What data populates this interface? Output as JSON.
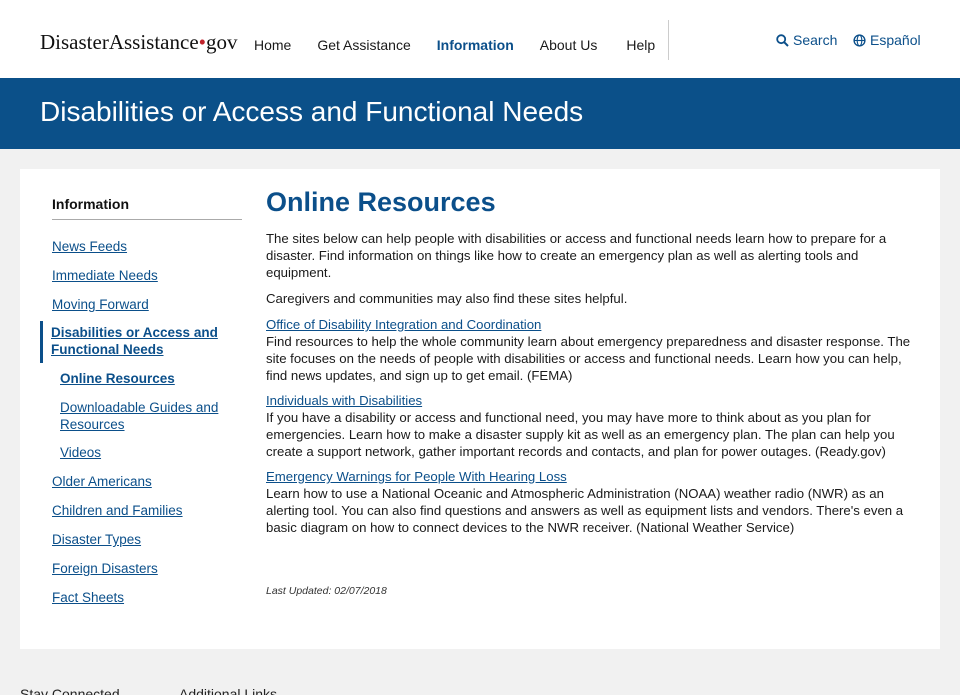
{
  "header": {
    "logo_main": "Disaster",
    "logo_second": "Assistance",
    "logo_dot": "•",
    "logo_tld": "gov",
    "nav": [
      "Home",
      "Get Assistance",
      "Information",
      "About Us",
      "Help"
    ],
    "search_label": "Search",
    "espanol_label": "Español"
  },
  "banner": {
    "title": "Disabilities or Access and Functional Needs"
  },
  "sidebar": {
    "title": "Information",
    "items": [
      "News Feeds",
      "Immediate Needs",
      "Moving Forward",
      "Disabilities or Access and Functional Needs",
      "Online Resources",
      "Downloadable Guides and Resources",
      "Videos",
      "Older Americans",
      "Children and Families",
      "Disaster Types",
      "Foreign Disasters",
      "Fact Sheets"
    ]
  },
  "main": {
    "title": "Online Resources",
    "intro1": "The sites below can help people with disabilities or access and functional needs learn how to prepare for a disaster. Find information on things like how to create an emergency plan as well as alerting tools and equipment.",
    "intro2": "Caregivers and communities may also find these sites helpful.",
    "resources": [
      {
        "link": "Office of Disability Integration and Coordination",
        "desc": "Find resources to help the whole community learn about emergency preparedness and disaster response. The site focuses on the needs of people with disabilities or access and functional needs. Learn how you can help, find news updates, and sign up to get email. (FEMA)"
      },
      {
        "link": "Individuals with Disabilities",
        "desc": "If you have a disability or access and functional need, you may have more to think about as you plan for emergencies. Learn how to make a disaster supply kit as well as an emergency plan. The plan can help you create a support network, gather important records and contacts, and plan for power outages. (Ready.gov)"
      },
      {
        "link": "Emergency Warnings for People With Hearing Loss",
        "desc": "Learn how to use a National Oceanic and Atmospheric Administration (NOAA) weather radio (NWR) as an alerting tool. You can also find questions and answers as well as equipment lists and vendors. There's even a basic diagram on how to connect devices to the NWR receiver. (National Weather Service)"
      }
    ],
    "last_updated": "Last Updated: 02/07/2018"
  },
  "footer": {
    "stay_connected": "Stay Connected",
    "additional_links": "Additional Links"
  },
  "colors": {
    "brand_blue": "#0b5089",
    "link_blue": "#0b4f8a",
    "logo_dot_red": "#c0232c"
  },
  "icons": [
    "search-icon",
    "globe-icon"
  ]
}
